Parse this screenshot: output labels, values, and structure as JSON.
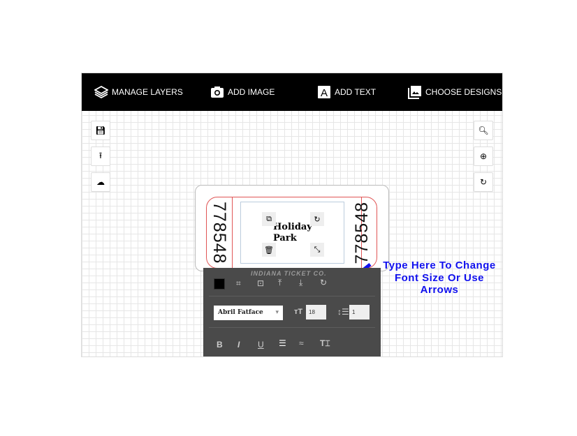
{
  "toolbar": {
    "manage_layers": "MANAGE LAYERS",
    "add_image": "ADD IMAGE",
    "add_text": "ADD TEXT",
    "choose_designs": "CHOOSE DESIGNS"
  },
  "ticket": {
    "number_left": "778548",
    "number_right": "778548",
    "text": "Holiday Park",
    "watermark": "INDIANA TICKET CO."
  },
  "text_panel": {
    "color": "#000000",
    "font": "Abril Fatface",
    "font_size": "18",
    "line_height": "1",
    "bold": "B",
    "italic": "I",
    "underline": "U"
  },
  "annotation": {
    "text": "Type Here To Change Font Size Or Use Arrows",
    "color": "#1010ee"
  }
}
